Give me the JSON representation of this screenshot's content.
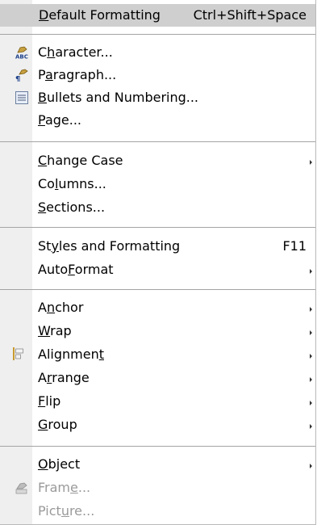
{
  "menu": {
    "default_formatting": {
      "pre": "",
      "u": "D",
      "post": "efault Formatting",
      "accel": "Ctrl+Shift+Space"
    },
    "character": {
      "pre": "C",
      "u": "h",
      "post": "aracter..."
    },
    "paragraph": {
      "pre": "P",
      "u": "a",
      "post": "ragraph..."
    },
    "bullets": {
      "pre": "",
      "u": "B",
      "post": "ullets and Numbering..."
    },
    "page": {
      "pre": "",
      "u": "P",
      "post": "age..."
    },
    "change_case": {
      "pre": "",
      "u": "C",
      "post": "hange Case"
    },
    "columns": {
      "pre": "Co",
      "u": "l",
      "post": "umns..."
    },
    "sections": {
      "pre": "",
      "u": "S",
      "post": "ections..."
    },
    "styles": {
      "pre": "St",
      "u": "y",
      "post": "les and Formatting",
      "accel": "F11"
    },
    "autoformat": {
      "pre": "Auto",
      "u": "F",
      "post": "ormat"
    },
    "anchor": {
      "pre": "A",
      "u": "n",
      "post": "chor"
    },
    "wrap": {
      "pre": "",
      "u": "W",
      "post": "rap"
    },
    "alignment": {
      "pre": "Alignmen",
      "u": "t",
      "post": ""
    },
    "arrange": {
      "pre": "A",
      "u": "r",
      "post": "range"
    },
    "flip": {
      "pre": "",
      "u": "F",
      "post": "lip"
    },
    "group": {
      "pre": "",
      "u": "G",
      "post": "roup"
    },
    "object": {
      "pre": "",
      "u": "O",
      "post": "bject"
    },
    "frame": {
      "pre": "Fram",
      "u": "e",
      "post": "..."
    },
    "picture": {
      "pre": "Pict",
      "u": "u",
      "post": "re..."
    }
  },
  "icons": {
    "character": "character-abc-icon",
    "paragraph": "paragraph-pilcrow-icon",
    "bullets": "bullets-numbering-icon",
    "alignment": "alignment-icon",
    "frame": "frame-icon"
  },
  "colors": {
    "highlight": "#cfcfcf",
    "disabled": "#9a9a9a",
    "strip": "#efefef",
    "separator": "#a4a4a4"
  }
}
